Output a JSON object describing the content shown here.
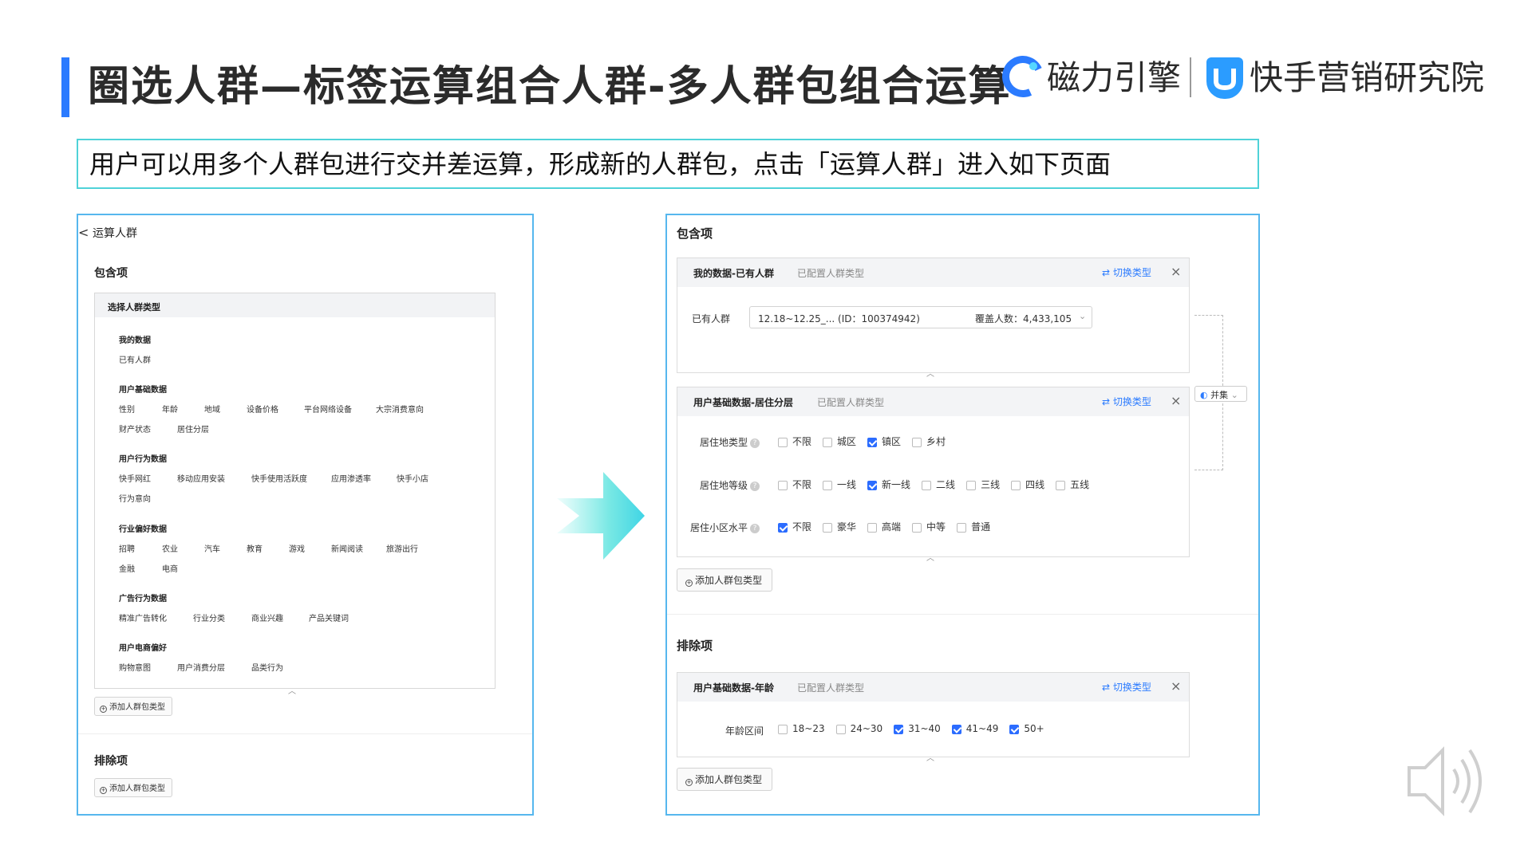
{
  "header": {
    "title": "圈选人群—标签运算组合人群-多人群包组合运算",
    "logo_left": "磁力引擎",
    "logo_right": "快手营销研究院"
  },
  "intro": "用户可以用多个人群包进行交并差运算，形成新的人群包，点击「运算人群」进入如下页面",
  "left_panel": {
    "back": "<",
    "title": "运算人群",
    "include_label": "包含项",
    "selector_header": "选择人群类型",
    "categories": [
      {
        "name": "我的数据",
        "options": [
          "已有人群"
        ]
      },
      {
        "name": "用户基础数据",
        "options": [
          "性别",
          "年龄",
          "地域",
          "设备价格",
          "平台网络设备",
          "大宗消费意向",
          "财产状态",
          "居住分层"
        ]
      },
      {
        "name": "用户行为数据",
        "options": [
          "快手网红",
          "移动应用安装",
          "快手使用活跃度",
          "应用渗透率",
          "快手小店",
          "行为意向"
        ]
      },
      {
        "name": "行业偏好数据",
        "options": [
          "招聘",
          "农业",
          "汽车",
          "教育",
          "游戏",
          "新闻阅读",
          "旅游出行",
          "金融",
          "电商"
        ]
      },
      {
        "name": "广告行为数据",
        "options": [
          "精准广告转化",
          "行业分类",
          "商业兴趣",
          "产品关键词"
        ]
      },
      {
        "name": "用户电商偏好",
        "options": [
          "购物意图",
          "用户消费分层",
          "品类行为"
        ]
      }
    ],
    "add_button": "添加人群包类型",
    "exclude_label": "排除项",
    "add_button_exclude": "添加人群包类型"
  },
  "right_panel": {
    "include_label": "包含项",
    "card1": {
      "title": "我的数据-已有人群",
      "subtitle": "已配置人群类型",
      "switch": "切换类型",
      "field_label": "已有人群",
      "field_value": "12.18~12.25_... (ID：100374942)",
      "field_coverage": "覆盖人数：4,433,105"
    },
    "card2": {
      "title": "用户基础数据-居住分层",
      "subtitle": "已配置人群类型",
      "switch": "切换类型",
      "rows": [
        {
          "label": "居住地类型",
          "options": [
            {
              "t": "不限",
              "on": false
            },
            {
              "t": "城区",
              "on": false
            },
            {
              "t": "镇区",
              "on": true
            },
            {
              "t": "乡村",
              "on": false
            }
          ]
        },
        {
          "label": "居住地等级",
          "options": [
            {
              "t": "不限",
              "on": false
            },
            {
              "t": "一线",
              "on": false
            },
            {
              "t": "新一线",
              "on": true
            },
            {
              "t": "二线",
              "on": false
            },
            {
              "t": "三线",
              "on": false
            },
            {
              "t": "四线",
              "on": false
            },
            {
              "t": "五线",
              "on": false
            }
          ]
        },
        {
          "label": "居住小区水平",
          "options": [
            {
              "t": "不限",
              "on": true
            },
            {
              "t": "豪华",
              "on": false
            },
            {
              "t": "高端",
              "on": false
            },
            {
              "t": "中等",
              "on": false
            },
            {
              "t": "普通",
              "on": false
            }
          ]
        }
      ]
    },
    "union": "并集",
    "add_button": "添加人群包类型",
    "exclude_label": "排除项",
    "card3": {
      "title": "用户基础数据-年龄",
      "subtitle": "已配置人群类型",
      "switch": "切换类型",
      "row_label": "年龄区间",
      "options": [
        {
          "t": "18~23",
          "on": false
        },
        {
          "t": "24~30",
          "on": false
        },
        {
          "t": "31~40",
          "on": true
        },
        {
          "t": "41~49",
          "on": true
        },
        {
          "t": "50+",
          "on": true
        }
      ]
    },
    "add_button_exclude": "添加人群包类型"
  },
  "colors": {
    "accent": "#2b7bff",
    "teal_border": "#4fd2d8",
    "panel_border": "#56b7ee"
  }
}
